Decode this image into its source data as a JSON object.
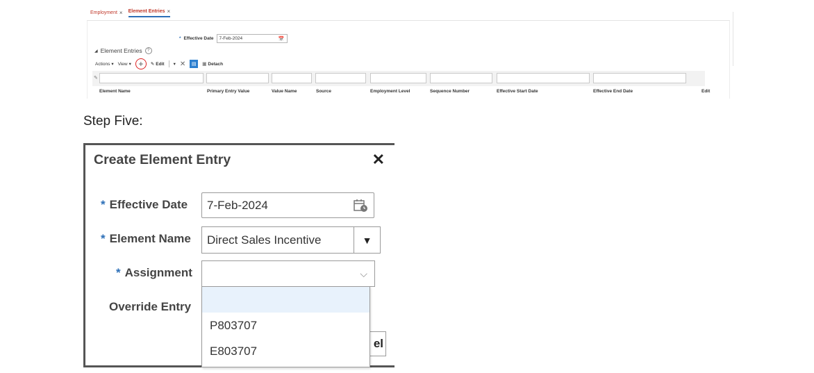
{
  "tabs": [
    {
      "label": "Employment",
      "active": false
    },
    {
      "label": "Element Entries",
      "active": true
    }
  ],
  "page": {
    "effective_date_label": "Effective Date",
    "effective_date_value": "7-Feb-2024",
    "section_title": "Element Entries",
    "toolbar": {
      "actions": "Actions",
      "view": "View",
      "edit": "Edit",
      "detach": "Detach"
    },
    "columns": [
      "Element Name",
      "Primary Entry Value",
      "Value Name",
      "Source",
      "Employment Level",
      "Sequence Number",
      "Effective Start Date",
      "Effective End Date",
      "Edit"
    ]
  },
  "step_label": "Step Five:",
  "dialog": {
    "title": "Create Element Entry",
    "close_icon": "close-icon",
    "fields": {
      "effective_date_label": "Effective Date",
      "effective_date_value": "7-Feb-2024",
      "element_name_label": "Element Name",
      "element_name_value": "Direct Sales Incentive",
      "assignment_label": "Assignment",
      "assignment_value": "",
      "override_label": "Override Entry"
    },
    "assignment_options": [
      "",
      "P803707",
      "E803707"
    ],
    "cancel_fragment": "el"
  },
  "colors": {
    "tab_text": "#c0392b",
    "required_star": "#2c6fb7",
    "highlight_option": "#e8f2fc",
    "add_button_circle": "#dd2222"
  }
}
